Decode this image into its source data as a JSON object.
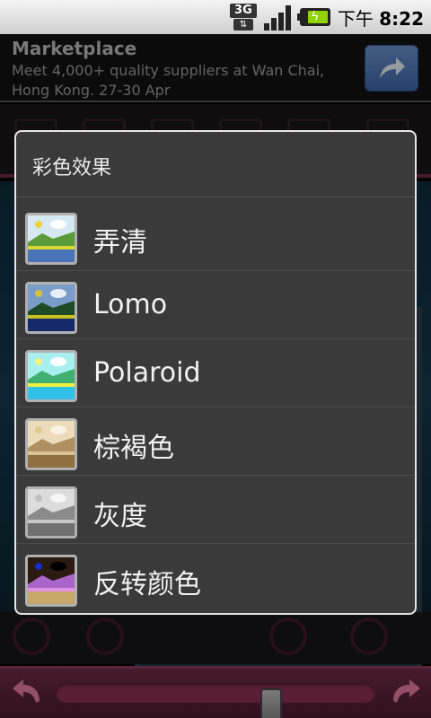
{
  "status_bar": {
    "network": "3G",
    "time_prefix": "下午",
    "time": "8:22"
  },
  "ad": {
    "title": "Marketplace",
    "description": "Meet 4,000+ quality suppliers at Wan Chai, Hong Kong. 27-30 Apr"
  },
  "dialog": {
    "title": "彩色效果",
    "options": [
      {
        "label": "弄清",
        "icon": "clarify-effect-icon"
      },
      {
        "label": "Lomo",
        "icon": "lomo-effect-icon"
      },
      {
        "label": "Polaroid",
        "icon": "polaroid-effect-icon"
      },
      {
        "label": "棕褐色",
        "icon": "sepia-effect-icon"
      },
      {
        "label": "灰度",
        "icon": "grayscale-effect-icon"
      },
      {
        "label": "反转颜色",
        "icon": "invert-colors-effect-icon"
      }
    ]
  },
  "colors": {
    "accent": "#6b2a45",
    "dialog_bg": "#3a3a3a"
  }
}
